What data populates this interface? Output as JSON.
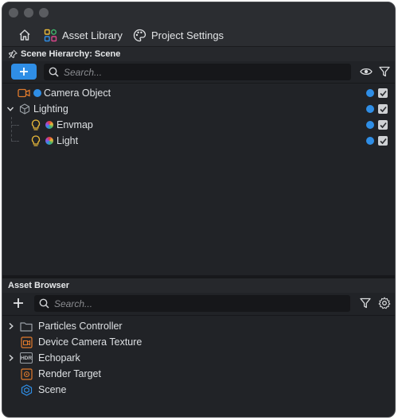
{
  "toolbar": {
    "asset_library_label": "Asset Library",
    "project_settings_label": "Project Settings"
  },
  "scene_hierarchy": {
    "title": "Scene Hierarchy: Scene",
    "search_placeholder": "Search...",
    "items": [
      {
        "label": "Camera Object",
        "icon": "camera-icon",
        "depth": 0,
        "visible": true,
        "enabled": true
      },
      {
        "label": "Lighting",
        "icon": "cube-icon",
        "depth": 0,
        "expanded": true,
        "visible": true,
        "enabled": true
      },
      {
        "label": "Envmap",
        "icon": "lightbulb-icon",
        "depth": 1,
        "visible": true,
        "enabled": true
      },
      {
        "label": "Light",
        "icon": "lightbulb-icon",
        "depth": 1,
        "visible": true,
        "enabled": true
      }
    ]
  },
  "asset_browser": {
    "title": "Asset Browser",
    "search_placeholder": "Search...",
    "items": [
      {
        "label": "Particles Controller",
        "icon": "folder-icon",
        "expandable": true
      },
      {
        "label": "Device Camera Texture",
        "icon": "camera-texture-icon",
        "expandable": false
      },
      {
        "label": "Echopark",
        "icon": "hdr-icon",
        "icon_text": "HDR",
        "expandable": true
      },
      {
        "label": "Render Target",
        "icon": "render-target-icon",
        "expandable": false
      },
      {
        "label": "Scene",
        "icon": "scene-icon",
        "expandable": false
      }
    ]
  },
  "colors": {
    "accent": "#2f8ee6",
    "orange": "#e07a2c",
    "yellow": "#e8b93a",
    "panel": "#212327",
    "toolbar": "#2b2d31"
  }
}
